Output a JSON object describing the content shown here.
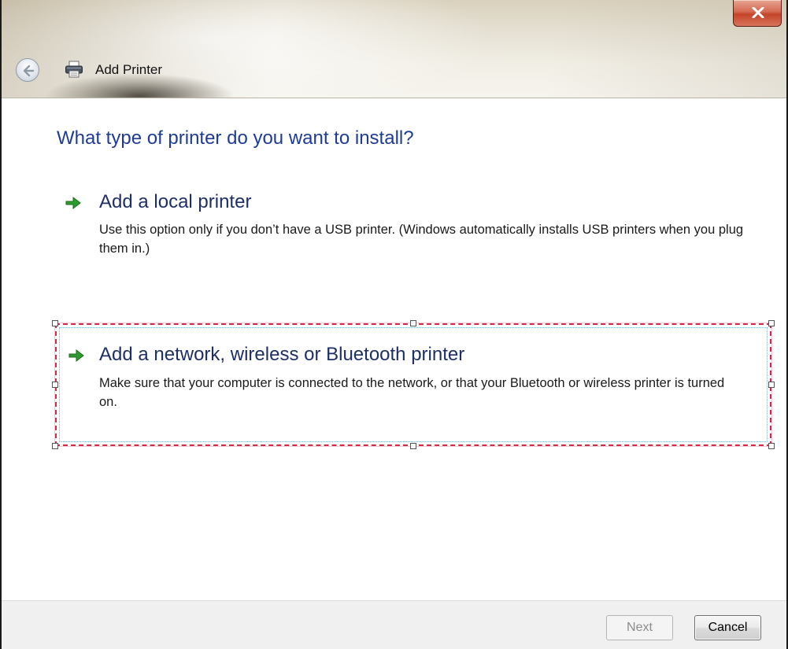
{
  "window": {
    "title": "Add Printer",
    "close_label": "X"
  },
  "page": {
    "heading": "What type of printer do you want to install?"
  },
  "options": [
    {
      "title": "Add a local printer",
      "description": "Use this option only if you don’t have a USB printer. (Windows automatically installs USB printers when you plug them in.)"
    },
    {
      "title": "Add a network, wireless or Bluetooth printer",
      "description": "Make sure that your computer is connected to the network, or that your Bluetooth or wireless printer is turned on.",
      "selected": true
    }
  ],
  "footer": {
    "next_label": "Next",
    "next_enabled": false,
    "cancel_label": "Cancel"
  },
  "colors": {
    "heading": "#1e3c96",
    "option_title": "#1e2f66",
    "arrow_green": "#2e9b2e",
    "selection_outline": "#d02a4a",
    "close_button": "#c4442a"
  },
  "icons": {
    "back": "back-arrow-icon",
    "printer": "printer-icon",
    "close": "close-icon",
    "option_arrow": "green-arrow-icon"
  }
}
